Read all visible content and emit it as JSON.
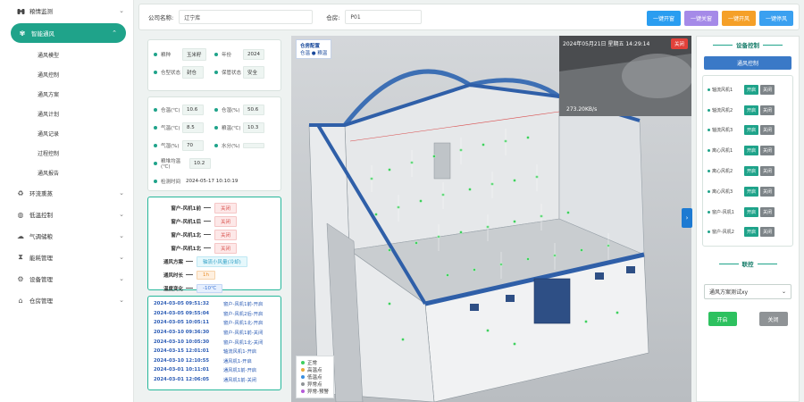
{
  "sidebar": {
    "items": [
      {
        "label": "粮情监测",
        "icon": "binoculars-icon"
      },
      {
        "label": "智能通风",
        "icon": "fan-icon",
        "active": true
      },
      {
        "label": "环流熏蒸",
        "icon": "recycle-icon"
      },
      {
        "label": "低温控制",
        "icon": "thermometer-icon"
      },
      {
        "label": "气调储粮",
        "icon": "gas-icon"
      },
      {
        "label": "能耗管理",
        "icon": "hourglass-icon"
      },
      {
        "label": "设备管理",
        "icon": "settings-icon"
      },
      {
        "label": "仓房管理",
        "icon": "warehouse-icon"
      }
    ],
    "submenu": [
      "通风模型",
      "通风控制",
      "通风方案",
      "通风计划",
      "通风记录",
      "过程控制",
      "通风报告"
    ]
  },
  "topbar": {
    "company_label": "公司名称:",
    "company_value": "辽宁库",
    "bin_label": "仓房:",
    "bin_value": "P01",
    "buttons": [
      {
        "label": "一键开窗",
        "color": "#2a9df0"
      },
      {
        "label": "一键关窗",
        "color": "#8c6fd8"
      },
      {
        "label": "一键开风",
        "color": "#f5a028"
      },
      {
        "label": "一键停风",
        "color": "#3aa0f0"
      }
    ]
  },
  "info1": [
    {
      "k": "粮种",
      "v": "玉米籽",
      "k2": "年份",
      "v2": "2024"
    },
    {
      "k": "仓型状态",
      "v": "封仓",
      "k2": "保管状态",
      "v2": "安全"
    }
  ],
  "info2": [
    {
      "k": "仓温(℃)",
      "v": "10.6",
      "k2": "仓湿(%)",
      "v2": "50.6"
    },
    {
      "k": "气温(℃)",
      "v": "8.5",
      "k2": "粮温(℃)",
      "v2": "10.3"
    },
    {
      "k": "气湿(%)",
      "v": "70",
      "k2": "水分(%)",
      "v2": ""
    }
  ],
  "info2_single": [
    {
      "k": "粮堆均温(℃)",
      "v": "10.2"
    },
    {
      "k": "检测时间",
      "v": "2024-05-17 10:10:19"
    }
  ],
  "controls": [
    {
      "label": "窗户-风机1前",
      "value": "关闭",
      "style": "red"
    },
    {
      "label": "窗户-风机1后",
      "value": "关闭",
      "style": "red"
    },
    {
      "label": "窗户-风机1北",
      "value": "关闭",
      "style": "red"
    },
    {
      "label": "窗户-风机1北",
      "value": "关闭",
      "style": "red"
    },
    {
      "label": "通风方案",
      "value": "轴流小风量(冷却)",
      "style": "cyan"
    },
    {
      "label": "通风时长",
      "value": "1h",
      "style": "orange"
    },
    {
      "label": "温度变化",
      "value": "-10℃",
      "style": "blue"
    }
  ],
  "logs": [
    {
      "time": "2024-03-05 09:51:32",
      "msg": "窗户-风机1前-开启"
    },
    {
      "time": "2024-03-05 09:55:04",
      "msg": "窗户-风机2后-开启"
    },
    {
      "time": "2024-03-05 10:05:11",
      "msg": "窗户-风机1北-开启"
    },
    {
      "time": "2024-03-10 09:36:30",
      "msg": "窗户-风机1前-关闭"
    },
    {
      "time": "2024-03-10 10:05:30",
      "msg": "窗户-风机1北-关闭"
    },
    {
      "time": "2024-03-15 12:01:01",
      "msg": "轴流风机1-开启"
    },
    {
      "time": "2024-03-10 12:10:55",
      "msg": "通风机1-开启"
    },
    {
      "time": "2024-03-01 10:11:01",
      "msg": "通风机1前-开启"
    },
    {
      "time": "2024-03-01 12:06:05",
      "msg": "通风机1前-关闭"
    }
  ],
  "viewer": {
    "config_title": "仓房配置",
    "config_options": "仓温  ● 粮温",
    "cam_time": "2024年05月21日 星期五 14:29:14",
    "cam_close": "关闭",
    "cam_speed": "273.20KB/s",
    "legend": [
      {
        "label": "正常",
        "color": "#3fcf5e"
      },
      {
        "label": "高温点",
        "color": "#e8a93a"
      },
      {
        "label": "低温点",
        "color": "#3b8fe0"
      },
      {
        "label": "异常点",
        "color": "#8f9396"
      },
      {
        "label": "异常-预警",
        "color": "#b55bd8"
      }
    ]
  },
  "right": {
    "title": "设备控制",
    "main_button": "通风控制",
    "devices": [
      {
        "name": "轴流风机1",
        "on": "开启",
        "off": "关闭"
      },
      {
        "name": "轴流风机2",
        "on": "开启",
        "off": "关闭"
      },
      {
        "name": "轴流风机3",
        "on": "开启",
        "off": "关闭"
      },
      {
        "name": "离心风机1",
        "on": "开启",
        "off": "关闭"
      },
      {
        "name": "离心风机2",
        "on": "开启",
        "off": "关闭"
      },
      {
        "name": "离心风机3",
        "on": "开启",
        "off": "关闭"
      },
      {
        "name": "窗户-风机1",
        "on": "开启",
        "off": "关闭"
      },
      {
        "name": "窗户-风机2",
        "on": "开启",
        "off": "关闭"
      }
    ],
    "link_title": "联控",
    "select_value": "通风方案测试xy",
    "start_label": "开启",
    "stop_label": "关闭"
  }
}
